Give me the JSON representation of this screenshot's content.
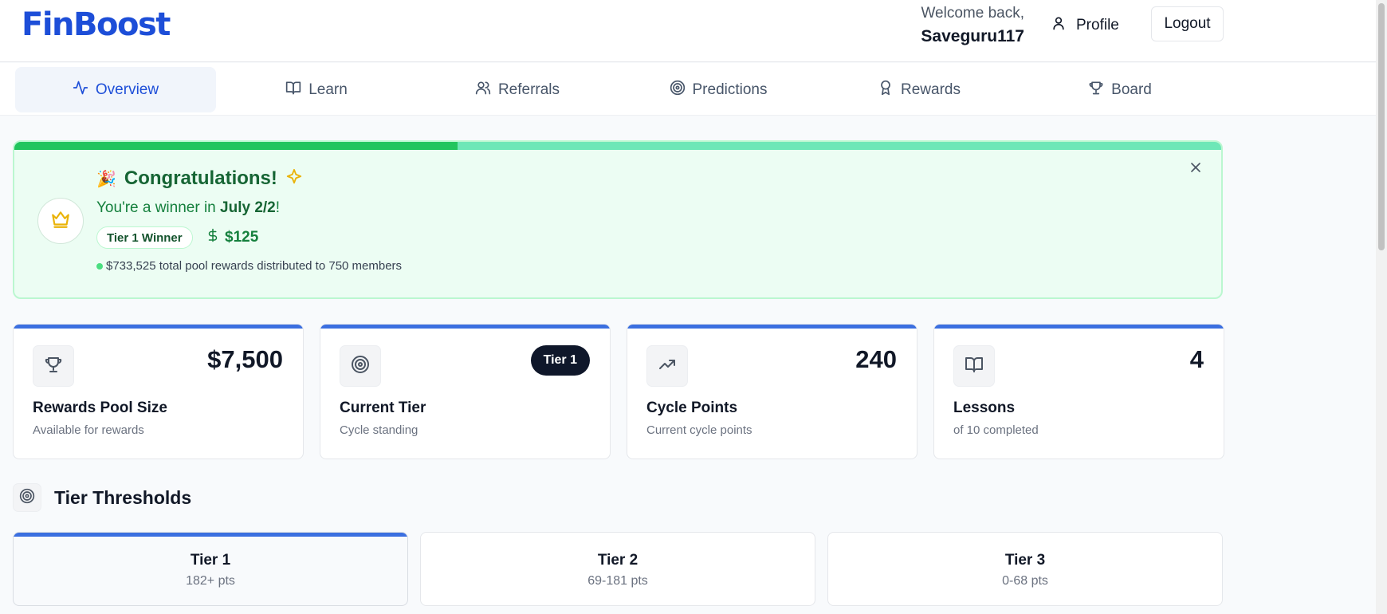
{
  "header": {
    "logo_text": "FinBoost",
    "welcome": "Welcome back,",
    "username": "Saveguru117",
    "profile_label": "Profile",
    "logout_label": "Logout"
  },
  "nav": {
    "tabs": [
      {
        "label": "Overview",
        "icon": "activity-icon",
        "active": true
      },
      {
        "label": "Learn",
        "icon": "book-open-icon"
      },
      {
        "label": "Referrals",
        "icon": "users-icon"
      },
      {
        "label": "Predictions",
        "icon": "target-icon"
      },
      {
        "label": "Rewards",
        "icon": "award-icon"
      },
      {
        "label": "Board",
        "icon": "trophy-icon"
      }
    ]
  },
  "banner": {
    "progress": 0.367,
    "party_emoji": "🎉",
    "title": "Congratulations!",
    "sparkle_emoji": "✨",
    "winner_prefix": "You're a winner in ",
    "cycle": "July 2/2",
    "winner_suffix": "!",
    "tier_badge": "Tier 1 Winner",
    "amount": "$125",
    "pool_text": "$733,525 total pool rewards distributed to 750 members"
  },
  "stats": [
    {
      "value": "$7,500",
      "label": "Rewards Pool Size",
      "sub": "Available for rewards",
      "icon": "trophy-icon"
    },
    {
      "badge": "Tier 1",
      "label": "Current Tier",
      "sub": "Cycle standing",
      "icon": "target-icon"
    },
    {
      "value": "240",
      "label": "Cycle Points",
      "sub": "Current cycle points",
      "icon": "trending-up-icon"
    },
    {
      "value": "4",
      "label": "Lessons",
      "sub": "of 10 completed",
      "icon": "book-open-icon"
    }
  ],
  "tier_section": {
    "title": "Tier Thresholds",
    "tiers": [
      {
        "name": "Tier 1",
        "range": "182+ pts",
        "current": true
      },
      {
        "name": "Tier 2",
        "range": "69-181 pts"
      },
      {
        "name": "Tier 3",
        "range": "0-68 pts"
      }
    ]
  },
  "colors": {
    "brand": "#1d4ed8",
    "accent_bar": "#3b6fe0",
    "success": "#22c55e",
    "success_light": "#6ee7b7",
    "banner_bg": "#ecfdf3",
    "crown": "#eab308"
  }
}
